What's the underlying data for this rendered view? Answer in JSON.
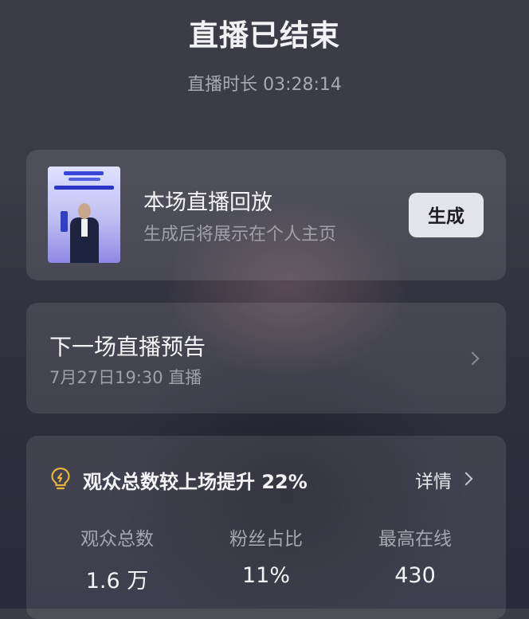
{
  "header": {
    "title": "直播已结束",
    "duration": "直播时长 03:28:14"
  },
  "replay_card": {
    "title": "本场直播回放",
    "subtitle": "生成后将展示在个人主页",
    "button_label": "生成",
    "thumbnail": "live-cover-image"
  },
  "next_live_card": {
    "title": "下一场直播预告",
    "schedule": "7月27日19:30 直播",
    "chevron": "chevron-right-icon"
  },
  "stats_card": {
    "icon": "lightbulb-icon",
    "headline": "观众总数较上场提升 22%",
    "detail_label": "详情",
    "items": [
      {
        "label": "观众总数",
        "value": "1.6 万"
      },
      {
        "label": "粉丝占比",
        "value": "11%"
      },
      {
        "label": "最高在线",
        "value": "430"
      }
    ]
  },
  "colors": {
    "accent_bulb": "#e6b43c",
    "card_bg": "rgba(255,255,255,0.10)"
  }
}
